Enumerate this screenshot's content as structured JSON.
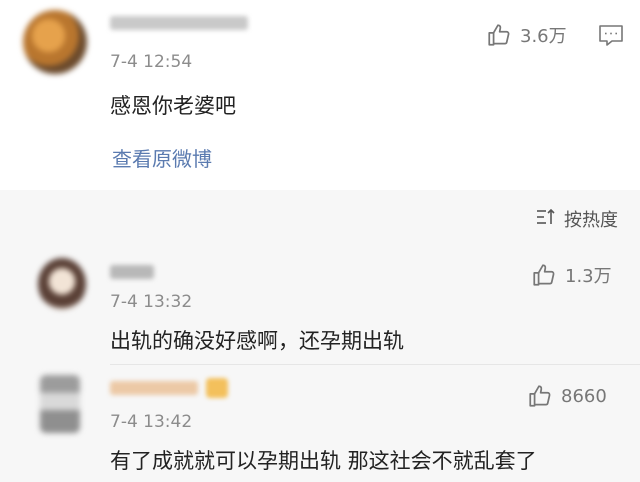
{
  "main_comment": {
    "time": "7-4 12:54",
    "text": "感恩你老婆吧",
    "likes": "3.6万",
    "view_original_label": "查看原微博"
  },
  "sort": {
    "label": "按热度"
  },
  "comments": [
    {
      "time": "7-4 13:32",
      "text": "出轨的确没好感啊，还孕期出轨",
      "likes": "1.3万"
    },
    {
      "time": "7-4 13:42",
      "text": "有了成就就可以孕期出轨 那这社会不就乱套了",
      "likes": "8660"
    }
  ],
  "icons": {
    "like": "thumbs-up-icon",
    "comment": "comment-icon",
    "sort": "sort-icon"
  },
  "colors": {
    "link": "#5b7bb0",
    "background": "#f7f7f7",
    "card": "#ffffff"
  }
}
